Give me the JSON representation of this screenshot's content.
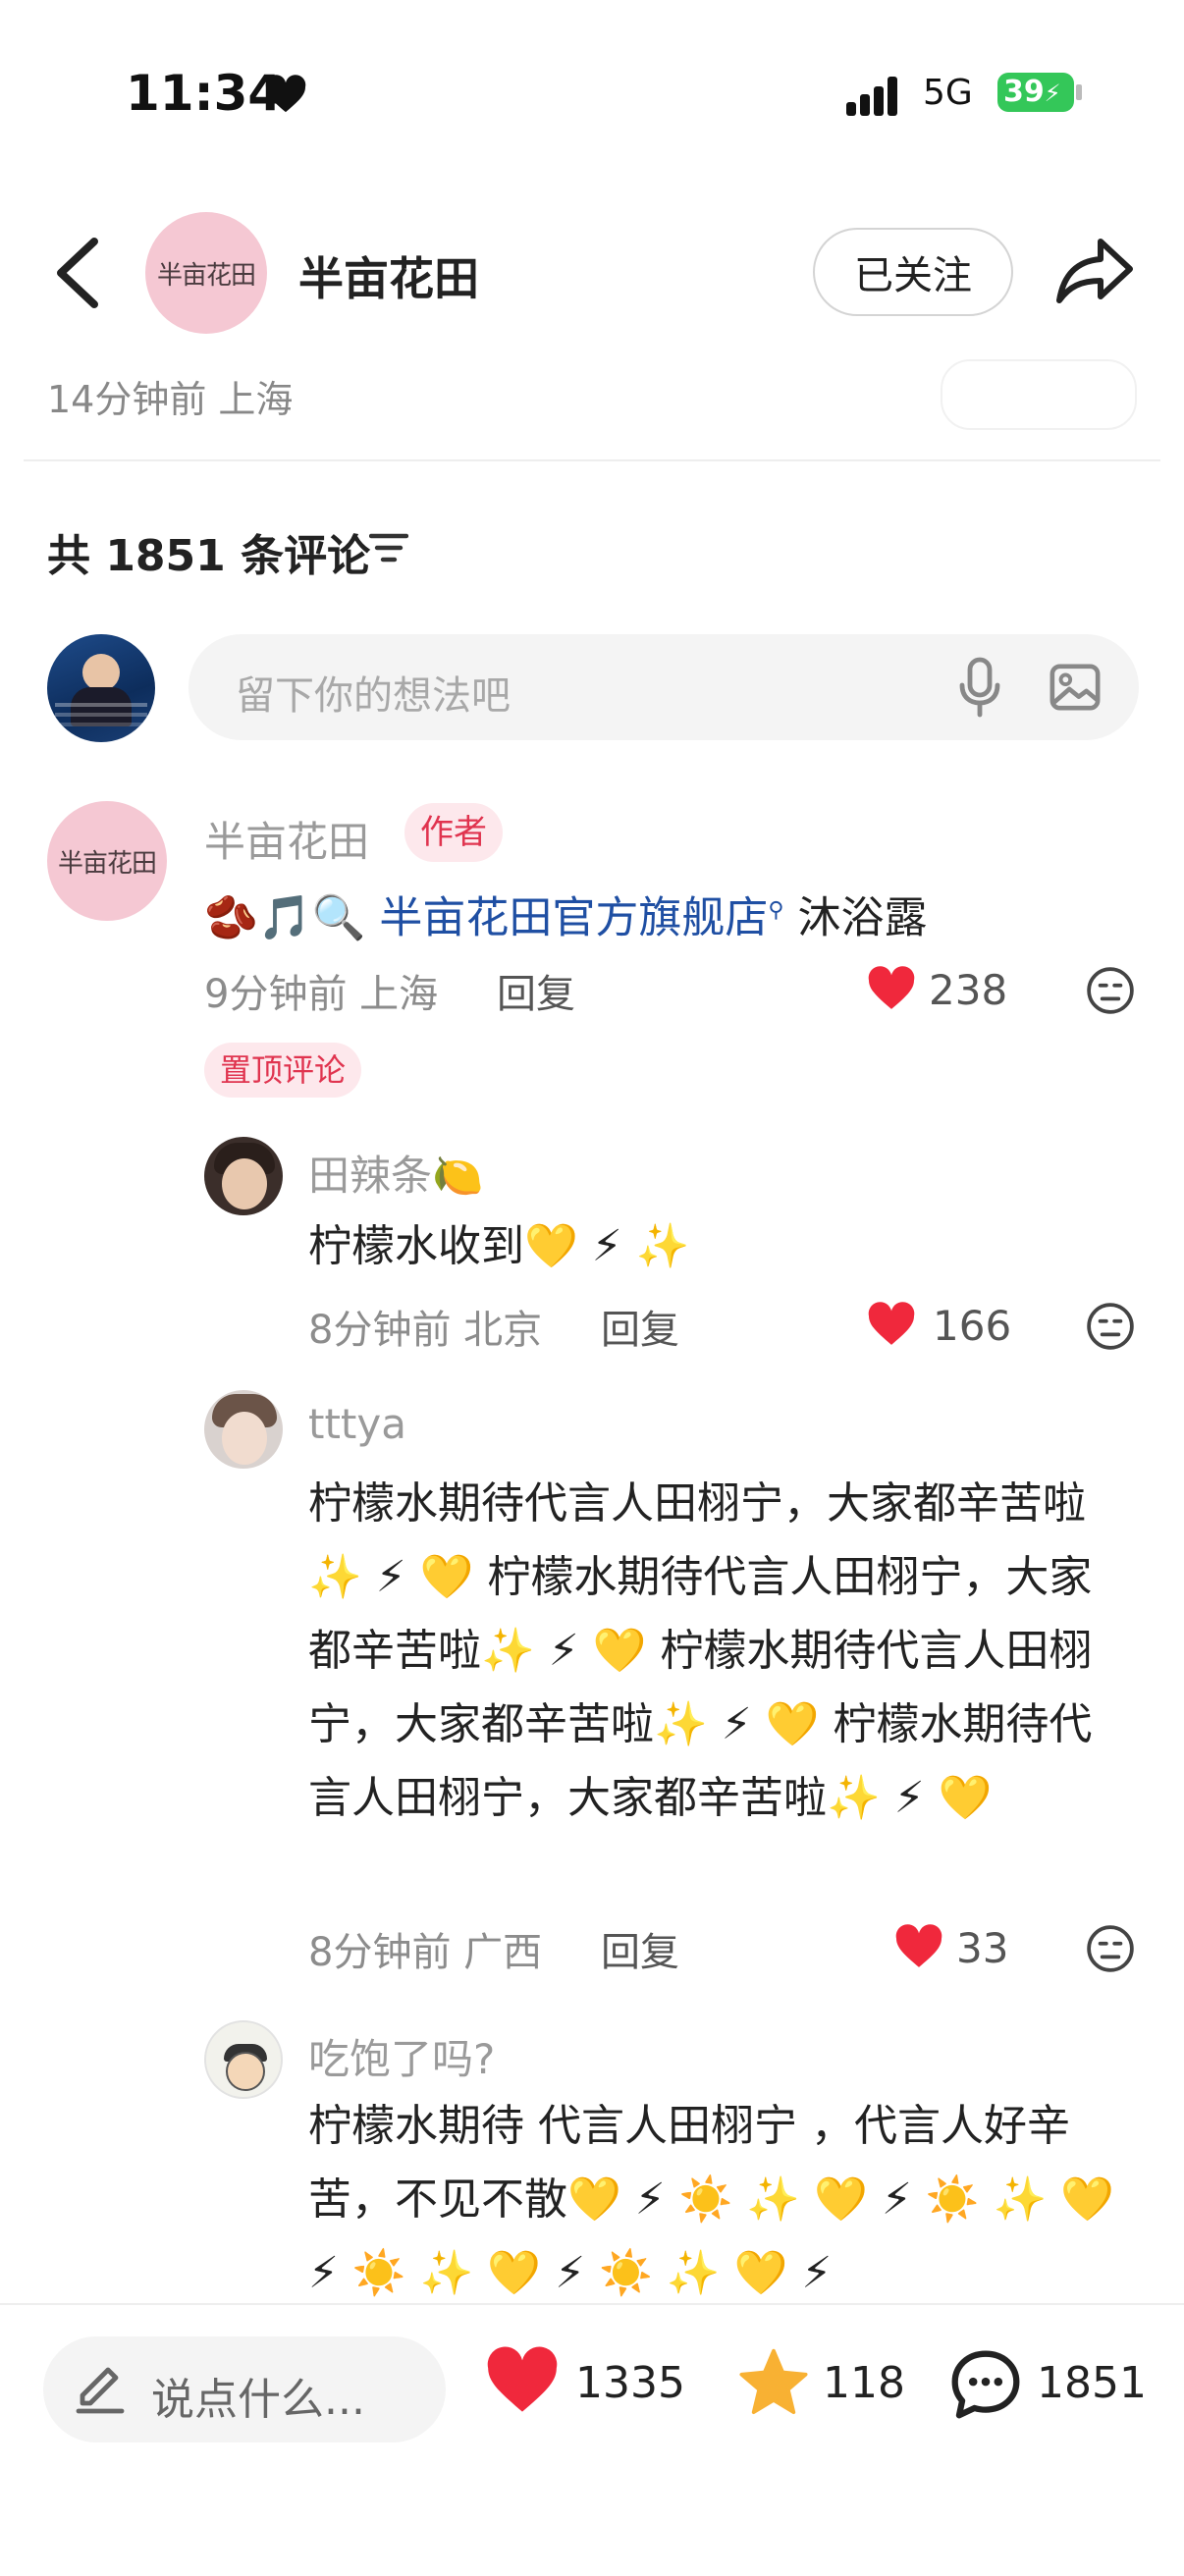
{
  "status_bar": {
    "time": "11:34",
    "network": "5G",
    "battery": "39"
  },
  "header": {
    "author_avatar_text": "半亩花田",
    "author_name": "半亩花田",
    "follow_label": "已关注",
    "post_time_location": "14分钟前 上海"
  },
  "comments_header": {
    "total": "共 1851 条评论"
  },
  "comment_input": {
    "placeholder": "留下你的想法吧"
  },
  "comments": [
    {
      "avatar_text": "半亩花田",
      "name": "半亩花田",
      "badge": "作者",
      "emoji_prefix": "🫘🎵🔍",
      "link": "半亩花田官方旗舰店",
      "link_suffix": " 沐浴露",
      "time_location": "9分钟前 上海",
      "reply_label": "回复",
      "likes": "238",
      "pin_label": "置顶评论"
    },
    {
      "name": "田辣条🍋",
      "text": "柠檬水收到💛 ⚡ ✨",
      "time_location": "8分钟前 北京",
      "reply_label": "回复",
      "likes": "166"
    },
    {
      "name": "tttya",
      "text": "柠檬水期待代言人田栩宁，大家都辛苦啦✨ ⚡ 💛 柠檬水期待代言人田栩宁，大家都辛苦啦✨ ⚡ 💛 柠檬水期待代言人田栩宁，大家都辛苦啦✨ ⚡ 💛 柠檬水期待代言人田栩宁，大家都辛苦啦✨ ⚡ 💛",
      "time_location": "8分钟前 广西",
      "reply_label": "回复",
      "likes": "33"
    },
    {
      "name": "吃饱了吗?",
      "text": "柠檬水期待 代言人田栩宁 ，代言人好辛苦，不见不散💛 ⚡ ☀️ ✨ 💛 ⚡ ☀️ ✨ 💛 ⚡ ☀️ ✨ 💛 ⚡ ☀️ ✨ 💛 ⚡"
    }
  ],
  "bottom_bar": {
    "input_placeholder": "说点什么...",
    "likes": "1335",
    "stars": "118",
    "comments": "1851"
  },
  "colors": {
    "like_red": "#f0283c",
    "star_yellow": "#f8b133",
    "link_blue": "#1f4fa3",
    "badge_red": "#e0344f"
  }
}
